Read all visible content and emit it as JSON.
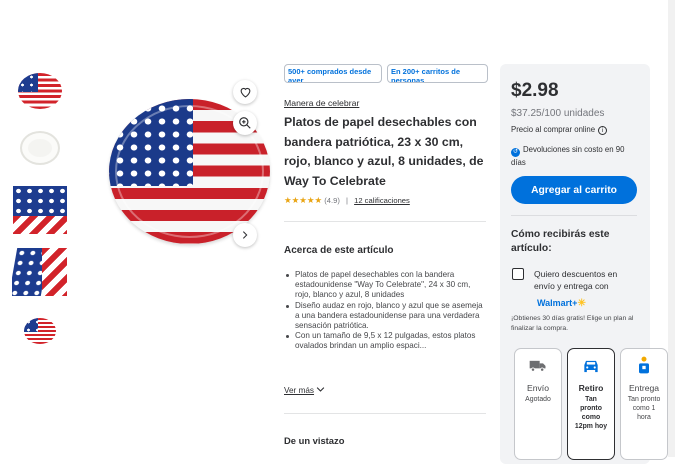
{
  "badges": {
    "purchased": "500+ comprados desde ayer",
    "carts": "En 200+ carritos de personas"
  },
  "brand": "Manera de celebrar",
  "title": "Platos de papel desechables con bandera patriótica, 23 x 30 cm, rojo, blanco y azul, 8 unidades, de Way To Celebrate",
  "rating": {
    "stars": "★★★★★",
    "value": "(4.9)",
    "separator": "|",
    "reviews": "12 calificaciones"
  },
  "about": {
    "heading": "Acerca de este artículo",
    "bullets": [
      "Platos de papel desechables con la bandera estadounidense \"Way To Celebrate\", 24 x 30 cm, rojo, blanco y azul, 8 unidades",
      "Diseño audaz en rojo, blanco y azul que se asemeja a una bandera estadounidense para una verdadera sensación patriótica.",
      "Con un tamaño de 9,5 x 12 pulgadas, estos platos ovalados brindan un amplio espaci..."
    ],
    "see_more": "Ver más"
  },
  "glance_heading": "De un vistazo",
  "buybox": {
    "price": "$2.98",
    "unit_price": "$37.25/100 unidades",
    "online_price": "Precio al comprar online",
    "info_icon": "i",
    "returns": "Devoluciones sin costo en 90 días",
    "add_to_cart": "Agregar al carrito",
    "how_heading": "Cómo recibirás este artículo:",
    "walmart_plus_offer": "Quiero descuentos en envío y entrega con",
    "walmart_plus_logo": "Walmart+",
    "trial": "¡Obtienes 30 días gratis! Elige un plan al finalizar la compra.",
    "options": [
      {
        "label": "Envío",
        "sub": "Agotado"
      },
      {
        "label": "Retiro",
        "sub": "Tan pronto como 12pm hoy"
      },
      {
        "label": "Entrega",
        "sub": "Tan pronto como 1 hora"
      }
    ]
  },
  "colors": {
    "accent": "#0071dc",
    "spark": "#ffc220",
    "flag_red": "#d2232a",
    "flag_blue": "#1d3c8f"
  },
  "icons": [
    "heart-icon",
    "zoom-in-icon",
    "chevron-right-icon",
    "chevron-down-icon",
    "info-icon",
    "truck-icon",
    "pickup-car-icon",
    "delivery-person-icon"
  ]
}
